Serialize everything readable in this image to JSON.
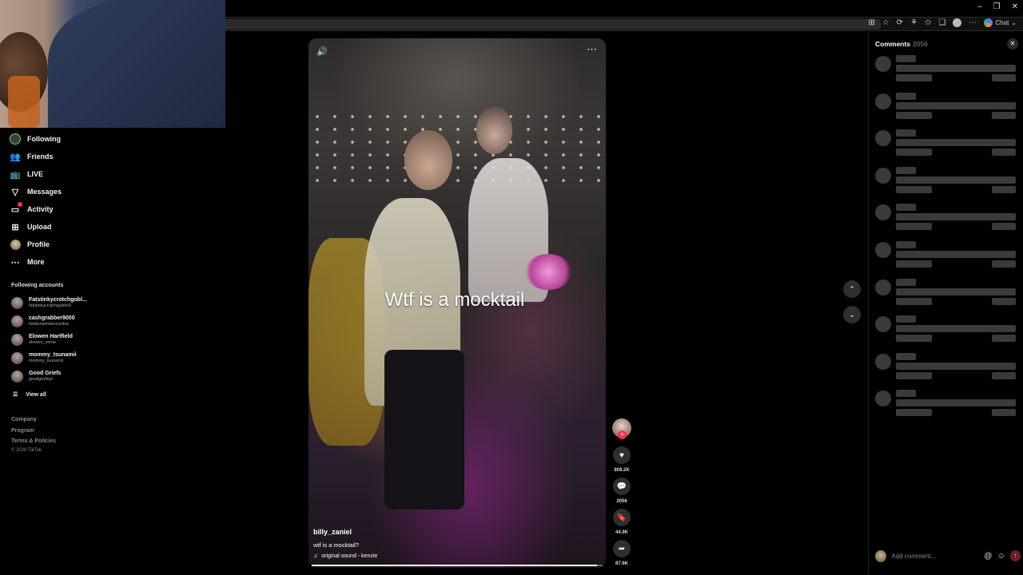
{
  "browser": {
    "chat_label": "Chat",
    "window_controls": [
      "–",
      "❐",
      "✕"
    ]
  },
  "sidebar": {
    "nav": [
      {
        "label": "Following",
        "icon": "following-avatar-icon"
      },
      {
        "label": "Friends",
        "icon": "friends-icon"
      },
      {
        "label": "LIVE",
        "icon": "live-icon"
      },
      {
        "label": "Messages",
        "icon": "messages-icon"
      },
      {
        "label": "Activity",
        "icon": "activity-icon"
      },
      {
        "label": "Upload",
        "icon": "upload-icon"
      },
      {
        "label": "Profile",
        "icon": "profile-avatar-icon"
      },
      {
        "label": "More",
        "icon": "more-icon"
      }
    ],
    "following_title": "Following accounts",
    "accounts": [
      {
        "name": "Fatstinkycrotchgobl...",
        "handle": "fatstinkycrotchgoblin0"
      },
      {
        "name": "cashgrabber9000",
        "handle": "holdenwindsoronline"
      },
      {
        "name": "Elowen Hartfield",
        "handle": "elowen_verse"
      },
      {
        "name": "mommy_tsunamii",
        "handle": "mommy_tsunamii"
      },
      {
        "name": "Good Griefs",
        "handle": "goodgriefsyt"
      }
    ],
    "view_all": "View all",
    "footer": {
      "company": "Company",
      "program": "Program",
      "terms": "Terms & Policies",
      "copyright": "© 2026 TikTok"
    }
  },
  "video": {
    "overlay_text": "Wtf is a mocktail",
    "author": "billy_zaniel",
    "description": "wtf is a mocktail?",
    "sound": "original sound - kenzie",
    "progress": 0.98
  },
  "actions": {
    "likes": "808.2K",
    "comments": "2056",
    "saves": "44.9K",
    "shares": "87.6K"
  },
  "comments": {
    "title": "Comments",
    "count": "2056",
    "placeholder": "Add comment..."
  },
  "colors": {
    "accent": "#fe2c55",
    "following_ring": "#2ce0c8"
  }
}
